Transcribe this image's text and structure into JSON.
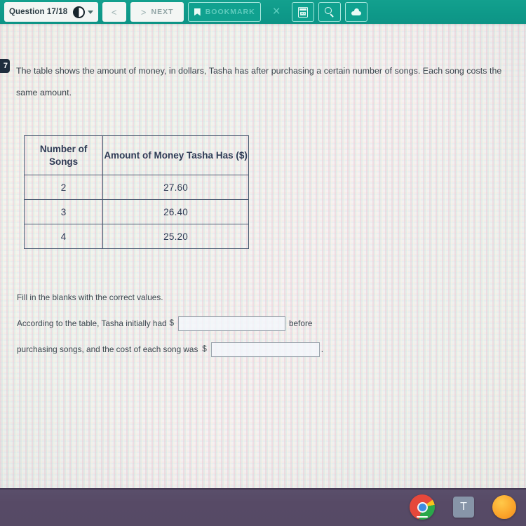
{
  "header": {
    "question_counter": "Question 17/18",
    "contrast_icon": "contrast-icon",
    "dropdown_icon": "chevron-down-icon",
    "prev_label": "<",
    "next_arrow": ">",
    "next_label": "NEXT",
    "bookmark_label": "BOOKMARK",
    "bookmark_icon": "bookmark-flag-icon",
    "close_label": "×",
    "calculator_icon": "calculator-icon",
    "search_icon": "search-icon",
    "cloud_icon": "cloud-icon"
  },
  "question": {
    "number_badge": "7",
    "prompt": "The table shows the amount of money, in dollars, Tasha has after purchasing a certain number of songs. Each song costs the same amount."
  },
  "chart_data": {
    "type": "table",
    "title": "",
    "columns": [
      "Number of Songs",
      "Amount of Money Tasha Has ($)"
    ],
    "rows": [
      [
        "2",
        "27.60"
      ],
      [
        "3",
        "26.40"
      ],
      [
        "4",
        "25.20"
      ]
    ],
    "categories": [
      2,
      3,
      4
    ],
    "values": [
      27.6,
      26.4,
      25.2
    ],
    "xlabel": "Number of Songs",
    "ylabel": "Amount of Money Tasha Has ($)"
  },
  "answer_section": {
    "instruction": "Fill in the blanks with the correct values.",
    "line1_before": "According to the table, Tasha initially had",
    "dollar_sign_1": "$",
    "blank1_value": "",
    "line1_after": "before",
    "line2_before": "purchasing songs, and the cost of each song was",
    "dollar_sign_2": "$",
    "blank2_value": "",
    "line2_after": "."
  },
  "taskbar": {
    "chrome_icon": "chrome-icon",
    "text_app_label": "T",
    "orange_icon": "orange-app-icon"
  }
}
